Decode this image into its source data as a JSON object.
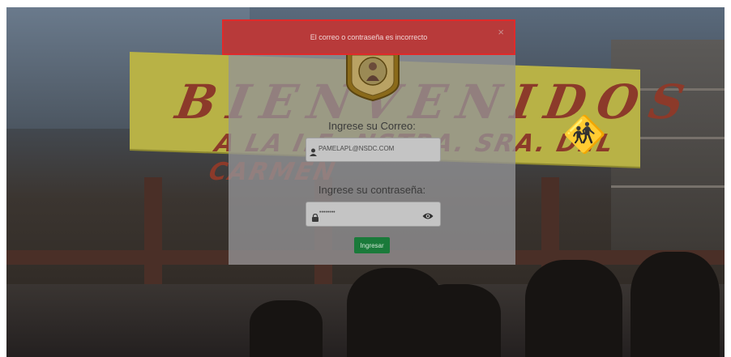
{
  "alert": {
    "message": "El correo o contraseña es incorrecto",
    "close_glyph": "×",
    "color": "#b83a3a"
  },
  "background": {
    "banner_line1": "BIENVENIDOS",
    "banner_line2": "A LA I.E. NSTRA. SRA. DEL CARMEN"
  },
  "login": {
    "email_label": "Ingrese su Correo:",
    "email_value": "PAMELAPL@NSDC.COM",
    "email_icon": "user-icon",
    "password_label": "Ingrese su contraseña:",
    "password_value": "••••••••",
    "password_icon": "lock-icon",
    "toggle_icon": "eye-icon",
    "submit_label": "Ingresar",
    "submit_color": "#1a7a3a"
  }
}
